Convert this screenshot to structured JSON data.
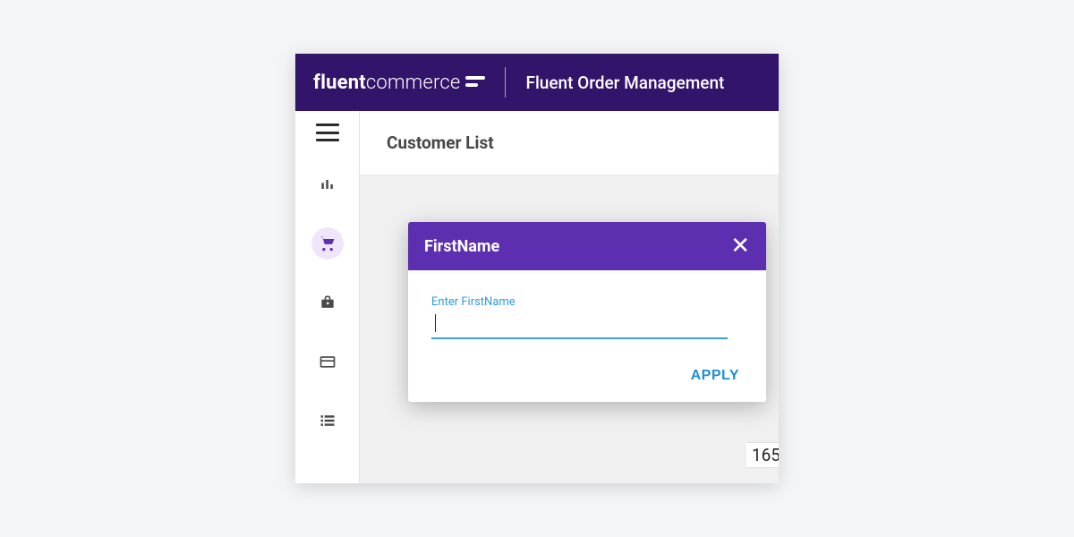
{
  "banner": {
    "brand_bold": "fluent",
    "brand_light": "commerce",
    "app_title": "Fluent Order Management"
  },
  "page": {
    "title": "Customer List"
  },
  "popover": {
    "title": "FirstName",
    "field_label": "Enter FirstName",
    "input_value": "",
    "apply_label": "APPLY"
  },
  "table_fragment": {
    "cell": "165"
  },
  "icons": {
    "menu": "menu",
    "dashboard": "bar-chart",
    "orders": "cart",
    "briefcase": "briefcase",
    "card": "card",
    "list": "list"
  }
}
